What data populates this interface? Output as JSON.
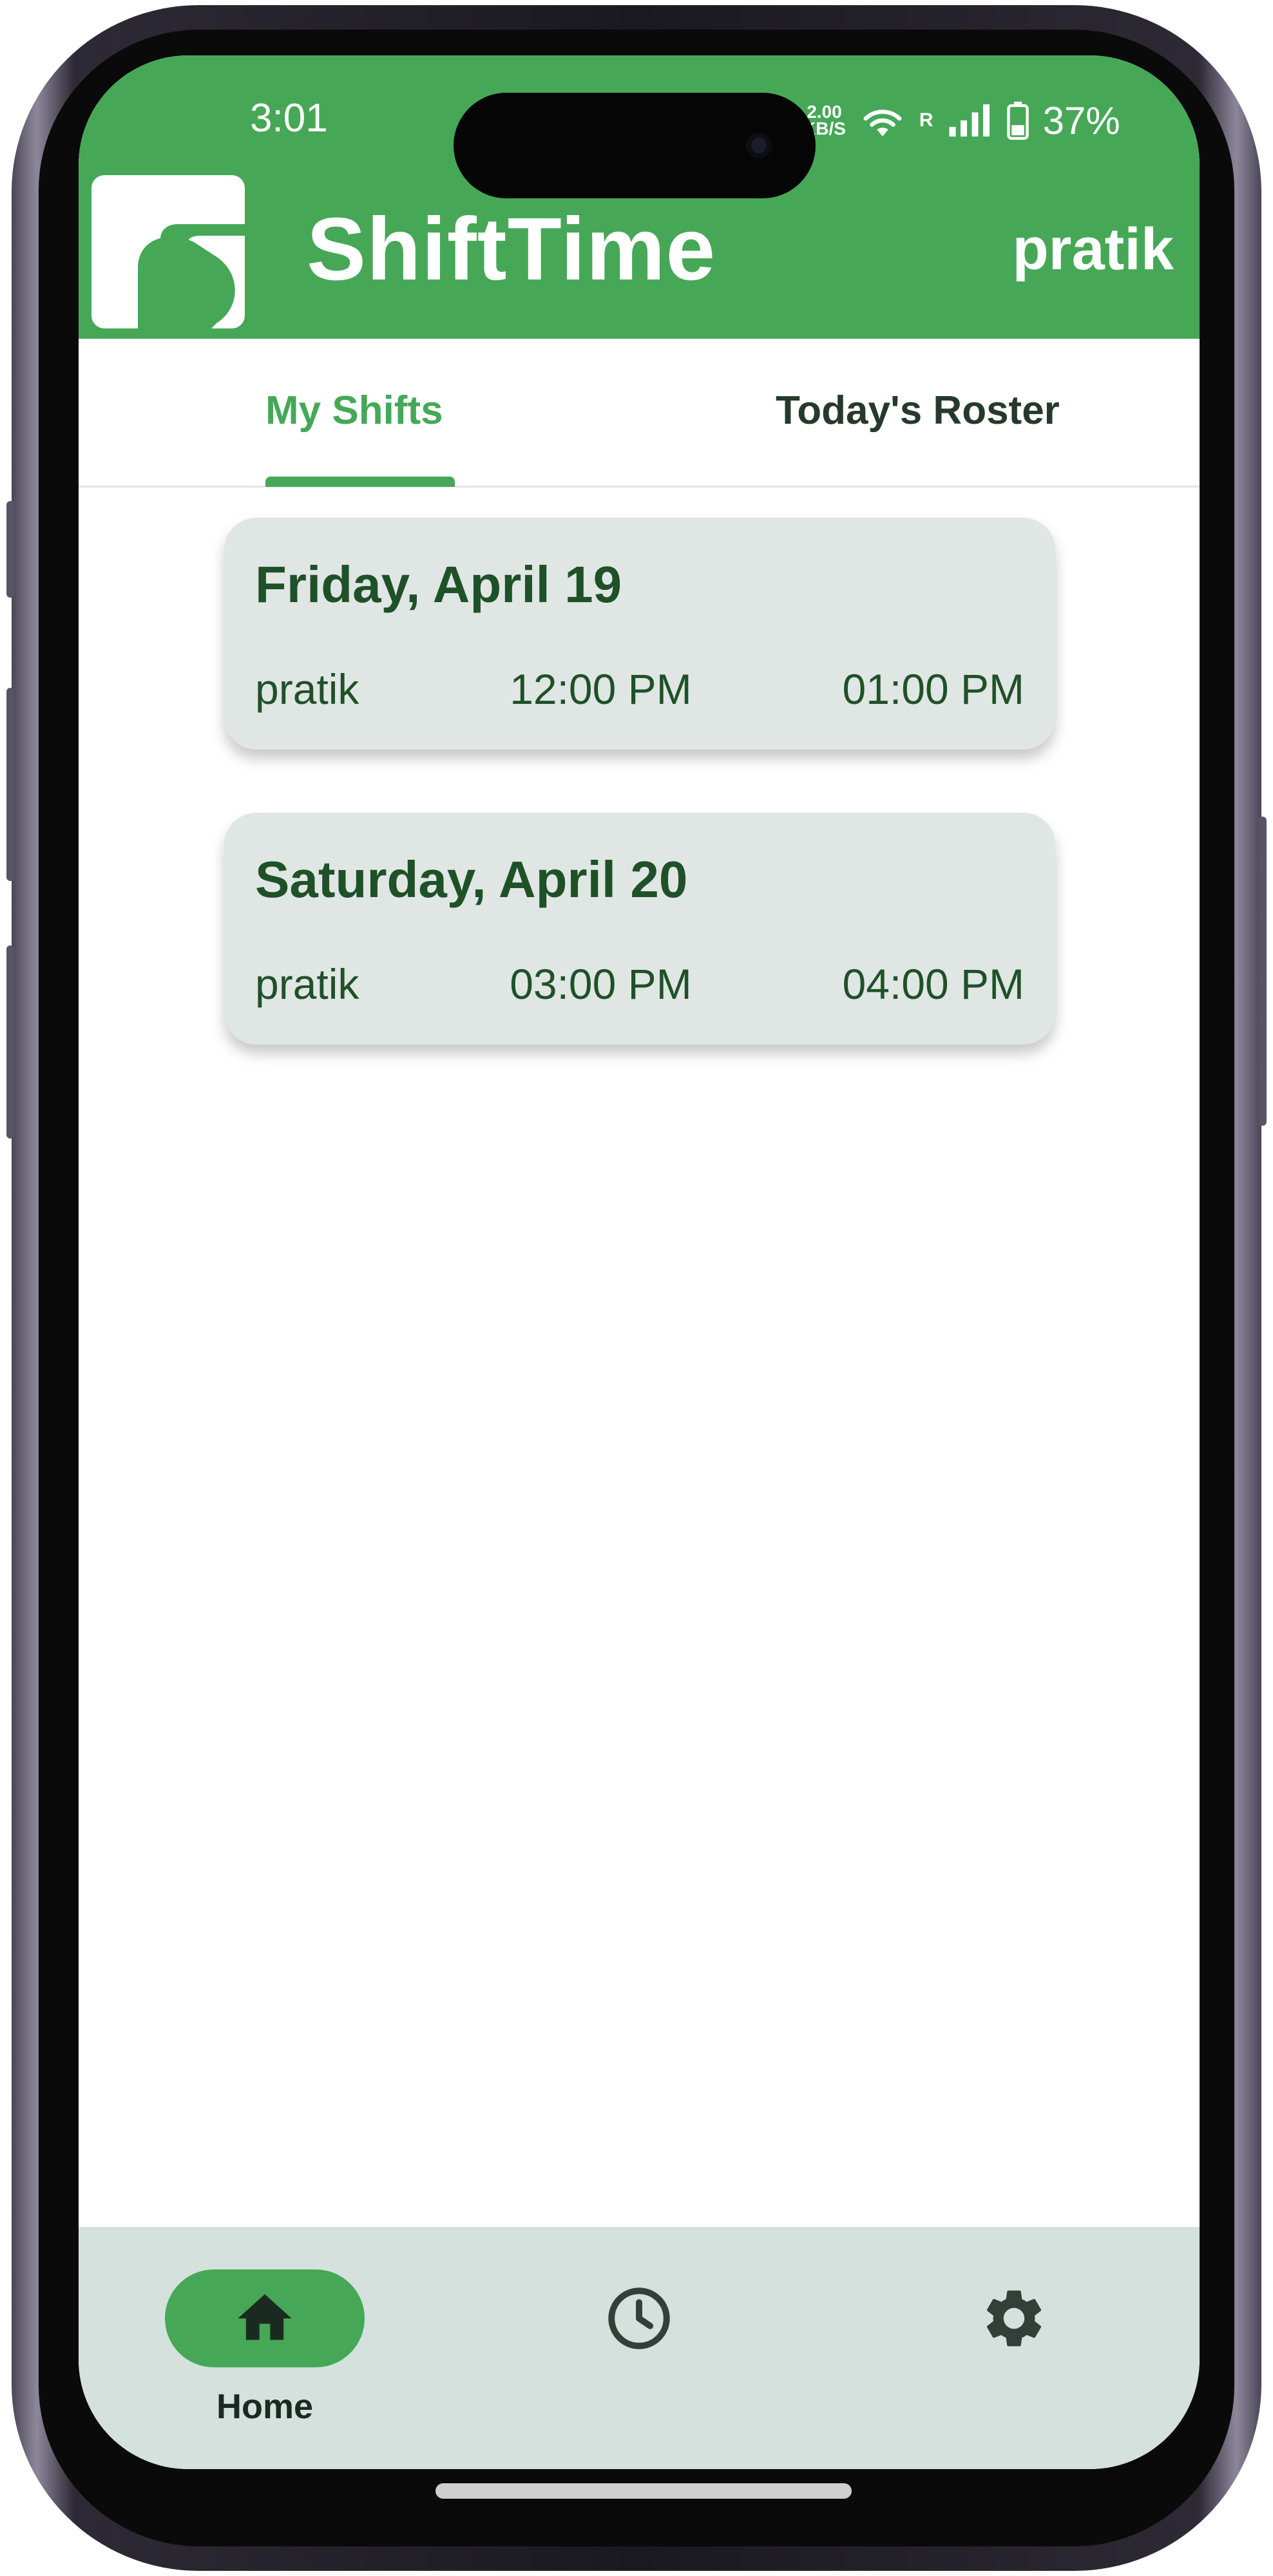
{
  "status_bar": {
    "time": "3:01",
    "net_speed_value": "2.00",
    "net_speed_unit": "KB/S",
    "signal_label": "R",
    "battery_percent": "37%"
  },
  "header": {
    "title": "ShiftTime",
    "user": "pratik",
    "color": "#46a857"
  },
  "tabs": [
    {
      "label": "My Shifts",
      "active": true
    },
    {
      "label": "Today's Roster",
      "active": false
    }
  ],
  "shifts": [
    {
      "date": "Friday, April 19",
      "user": "pratik",
      "start": "12:00 PM",
      "end": "01:00 PM"
    },
    {
      "date": "Saturday, April 20",
      "user": "pratik",
      "start": "03:00 PM",
      "end": "04:00 PM"
    }
  ],
  "bottom_nav": [
    {
      "label": "Home",
      "icon": "home-icon",
      "active": true
    },
    {
      "label": "",
      "icon": "clock-icon",
      "active": false
    },
    {
      "label": "",
      "icon": "gear-icon",
      "active": false
    }
  ]
}
